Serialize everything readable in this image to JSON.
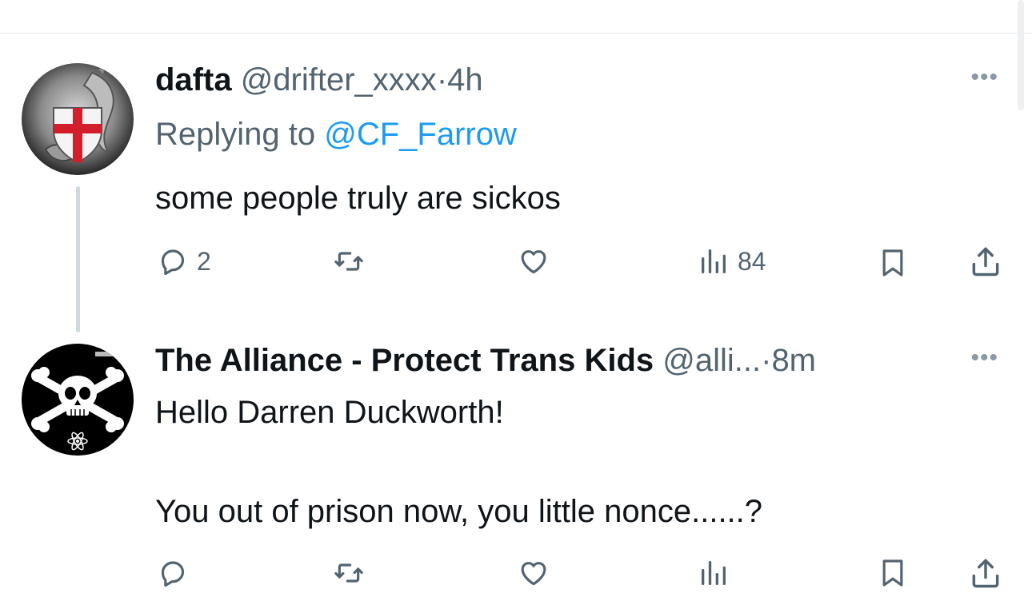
{
  "tweets": [
    {
      "name": "dafta",
      "handle": "@drifter_xxxx",
      "separator": "·",
      "time": "4h",
      "more": "•••",
      "replying_prefix": "Replying to",
      "replying_to": "@CF_Farrow",
      "text": "some people truly are sickos",
      "avatar_icon": "dragon-shield-icon",
      "actions": {
        "reply_count": "2",
        "retweet_count": "",
        "like_count": "",
        "views_count": "84"
      }
    },
    {
      "name": "The Alliance - Protect Trans Kids",
      "handle": "@alli...",
      "separator": "·",
      "time": "8m",
      "more": "•••",
      "text_line1": "Hello Darren Duckworth!",
      "text_line2": "You out of prison now, you little nonce......?",
      "avatar_icon": "skull-crossbones-icon",
      "actions": {
        "reply_count": "",
        "retweet_count": "",
        "like_count": "",
        "views_count": ""
      }
    }
  ],
  "colors": {
    "text": "#0f1419",
    "muted": "#536471",
    "link": "#1d9bf0",
    "thread_line": "#cfd9de",
    "flag_red": "#d21f2b"
  }
}
